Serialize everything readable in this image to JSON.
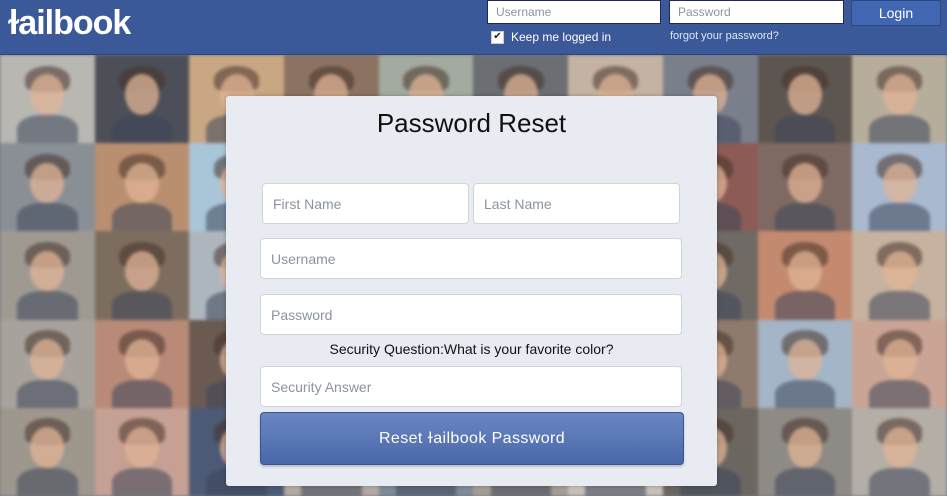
{
  "header": {
    "logo": "ɫailbook",
    "username_placeholder": "Username",
    "password_placeholder": "Password",
    "login_label": "Login",
    "keep_logged_in_label": "Keep me logged in",
    "keep_logged_in_checked": true,
    "forgot_label": "forgot your password?"
  },
  "reset_form": {
    "title": "Password Reset",
    "first_name_placeholder": "First Name",
    "last_name_placeholder": "Last Name",
    "username_placeholder": "Username",
    "password_placeholder": "Password",
    "security_question": "Security Question:What is your favorite color?",
    "security_answer_placeholder": "Security Answer",
    "submit_label": "Reset ɫailbook Password"
  },
  "background": {
    "tile_colors": [
      "#b9b7b2",
      "#4c4f57",
      "#c9a783",
      "#8c7361",
      "#a3aaa0",
      "#6b6e73",
      "#c4b3a3",
      "#7a7f8c",
      "#5d5650",
      "#b7ad9b",
      "#8a8f96",
      "#b98f6f",
      "#a9c5d8",
      "#c9b79f",
      "#d2cfcc",
      "#9aa0a6",
      "#c9d1dc",
      "#8c5b55",
      "#7f6a63",
      "#a9b9cf",
      "#9e9a92",
      "#7d6d5f",
      "#aeb6bd",
      "#c8c1b5",
      "#d9d6d2",
      "#b3b0aa",
      "#1f2a3a",
      "#6f6a63",
      "#c48a6f",
      "#c7b2a0",
      "#a7a39c",
      "#b98a78",
      "#6a5a52",
      "#d7cdc1",
      "#c9c5c0",
      "#bdb8b1",
      "#b0a99f",
      "#8f7b6d",
      "#a4b5c7",
      "#caa595",
      "#9e978d",
      "#c6a093",
      "#4d5a75",
      "#b3aaa0",
      "#7e8a96",
      "#a59d93",
      "#c8c0b6",
      "#6c6660",
      "#8e8a85",
      "#b5aea6"
    ]
  }
}
